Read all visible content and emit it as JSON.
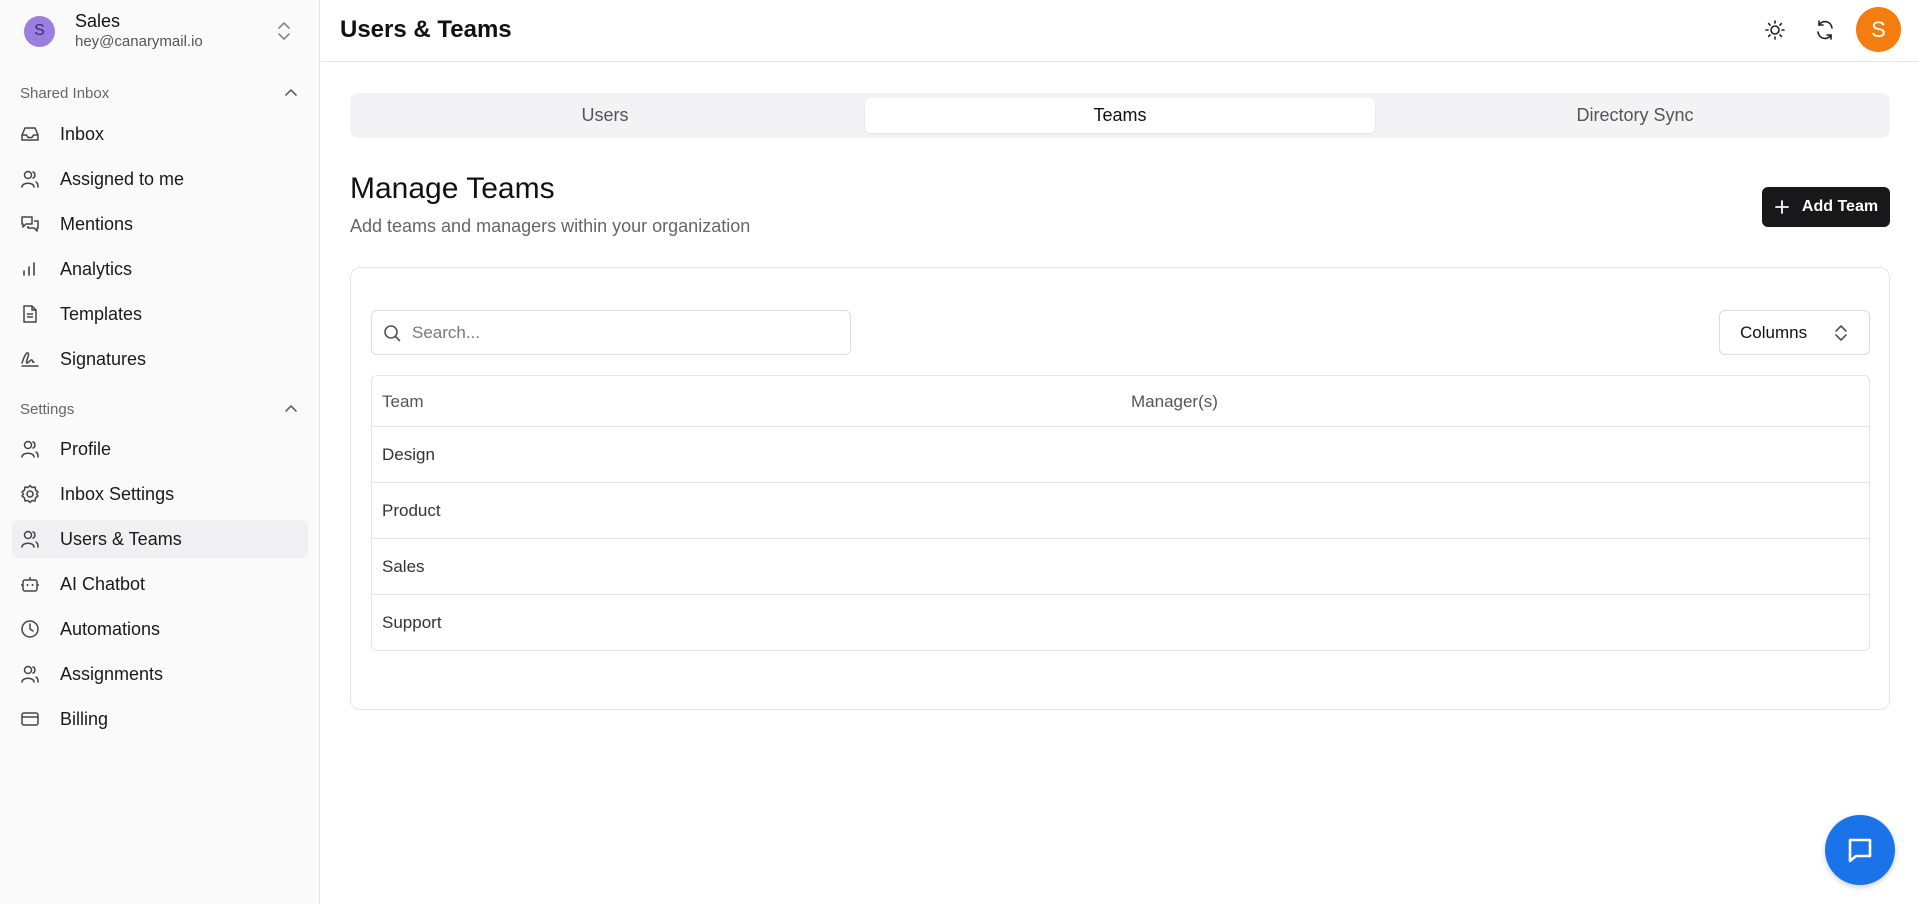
{
  "account": {
    "initial": "S",
    "name": "Sales",
    "email": "hey@canarymail.io"
  },
  "sidebar": {
    "shared_inbox_header": "Shared Inbox",
    "shared_inbox_items": [
      {
        "label": "Inbox",
        "icon": "inbox-icon"
      },
      {
        "label": "Assigned to me",
        "icon": "user-icon"
      },
      {
        "label": "Mentions",
        "icon": "chat-icon"
      },
      {
        "label": "Analytics",
        "icon": "bar-chart-icon"
      },
      {
        "label": "Templates",
        "icon": "file-icon"
      },
      {
        "label": "Signatures",
        "icon": "signature-icon"
      }
    ],
    "settings_header": "Settings",
    "settings_items": [
      {
        "label": "Profile",
        "icon": "users-icon"
      },
      {
        "label": "Inbox Settings",
        "icon": "gear-icon"
      },
      {
        "label": "Users & Teams",
        "icon": "users-icon",
        "active": true
      },
      {
        "label": "AI Chatbot",
        "icon": "bot-icon"
      },
      {
        "label": "Automations",
        "icon": "clock-icon"
      },
      {
        "label": "Assignments",
        "icon": "users-icon"
      },
      {
        "label": "Billing",
        "icon": "credit-card-icon"
      }
    ]
  },
  "header": {
    "title": "Users & Teams",
    "user_initial": "S"
  },
  "tabs": [
    {
      "label": "Users"
    },
    {
      "label": "Teams",
      "active": true
    },
    {
      "label": "Directory Sync"
    }
  ],
  "manage": {
    "title": "Manage Teams",
    "subtitle": "Add teams and managers within your organization",
    "add_button": "Add Team"
  },
  "search": {
    "placeholder": "Search...",
    "value": ""
  },
  "columns_button": "Columns",
  "table": {
    "headers": [
      "Team",
      "Manager(s)"
    ],
    "rows": [
      {
        "team": "Design",
        "managers": ""
      },
      {
        "team": "Product",
        "managers": ""
      },
      {
        "team": "Sales",
        "managers": ""
      },
      {
        "team": "Support",
        "managers": ""
      }
    ]
  },
  "colors": {
    "accent_avatar": "#f57c0f",
    "fab": "#1a73e8",
    "primary_button": "#18181b",
    "account_avatar": "#9b7fe0"
  }
}
